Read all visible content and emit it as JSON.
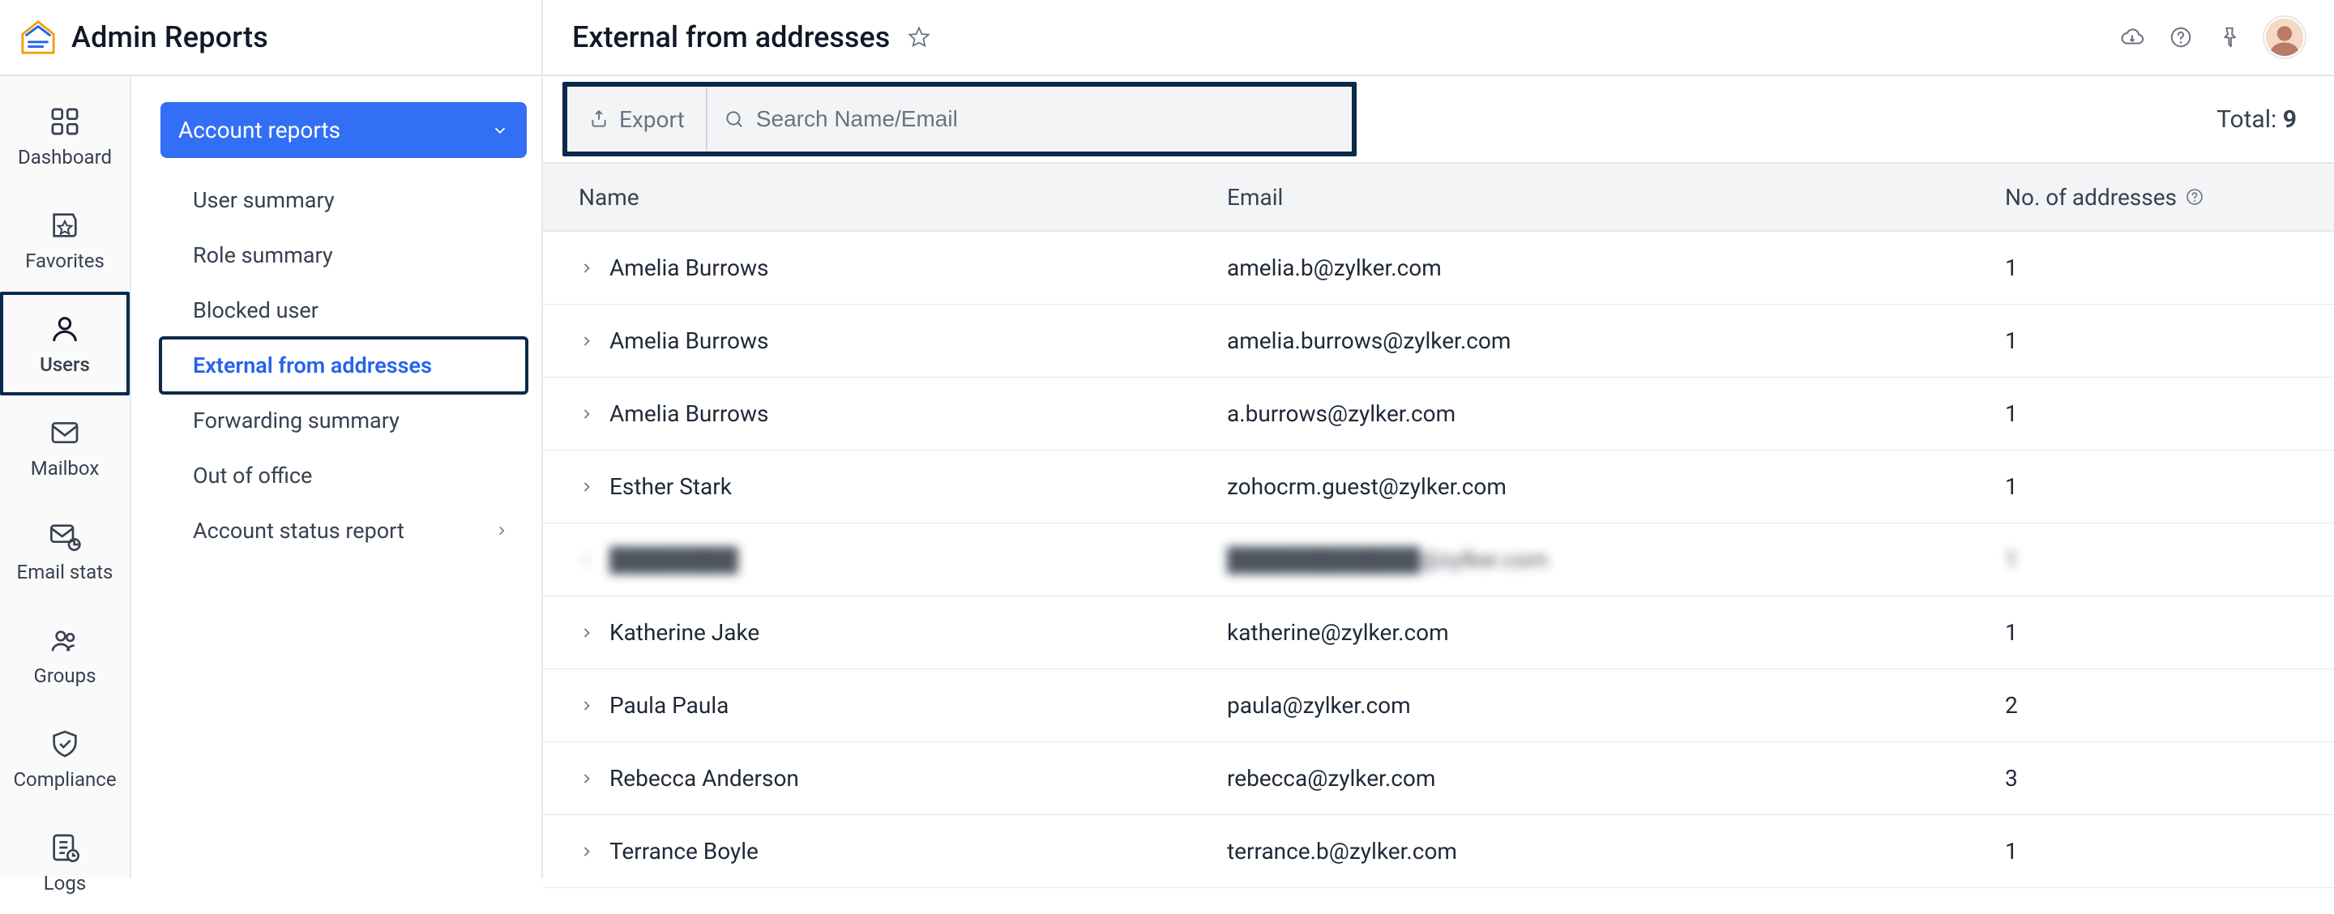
{
  "app": {
    "title": "Admin Reports"
  },
  "header": {
    "page_title": "External from addresses",
    "icons": {
      "download": "download-icon",
      "help": "help-icon",
      "pin": "pin-icon"
    }
  },
  "rail": {
    "items": [
      {
        "key": "dashboard",
        "label": "Dashboard"
      },
      {
        "key": "favorites",
        "label": "Favorites"
      },
      {
        "key": "users",
        "label": "Users",
        "active": true
      },
      {
        "key": "mailbox",
        "label": "Mailbox"
      },
      {
        "key": "email_stats",
        "label": "Email stats"
      },
      {
        "key": "groups",
        "label": "Groups"
      },
      {
        "key": "compliance",
        "label": "Compliance"
      },
      {
        "key": "logs",
        "label": "Logs"
      }
    ]
  },
  "sidebar": {
    "section_label": "Account reports",
    "items": [
      {
        "label": "User summary"
      },
      {
        "label": "Role summary"
      },
      {
        "label": "Blocked user"
      },
      {
        "label": "External from addresses",
        "active": true,
        "marked": true
      },
      {
        "label": "Forwarding summary"
      },
      {
        "label": "Out of office"
      },
      {
        "label": "Account status report",
        "has_children": true
      }
    ]
  },
  "toolbar": {
    "export_label": "Export",
    "search": {
      "placeholder": "Search Name/Email"
    },
    "total_label": "Total:",
    "total_value": "9"
  },
  "table": {
    "columns": {
      "name": "Name",
      "email": "Email",
      "addresses": "No. of addresses"
    },
    "rows": [
      {
        "name": "Amelia Burrows",
        "email": "amelia.b@zylker.com",
        "addresses": "1"
      },
      {
        "name": "Amelia Burrows",
        "email": "amelia.burrows@zylker.com",
        "addresses": "1"
      },
      {
        "name": "Amelia Burrows",
        "email": "a.burrows@zylker.com",
        "addresses": "1"
      },
      {
        "name": "Esther Stark",
        "email": "zohocrm.guest@zylker.com",
        "addresses": "1"
      },
      {
        "name": "████████",
        "email": "████████████@zylker.com",
        "addresses": "1",
        "blur": true
      },
      {
        "name": "Katherine Jake",
        "email": "katherine@zylker.com",
        "addresses": "1"
      },
      {
        "name": "Paula Paula",
        "email": "paula@zylker.com",
        "addresses": "2"
      },
      {
        "name": "Rebecca Anderson",
        "email": "rebecca@zylker.com",
        "addresses": "3"
      },
      {
        "name": "Terrance Boyle",
        "email": "terrance.b@zylker.com",
        "addresses": "1"
      }
    ]
  }
}
